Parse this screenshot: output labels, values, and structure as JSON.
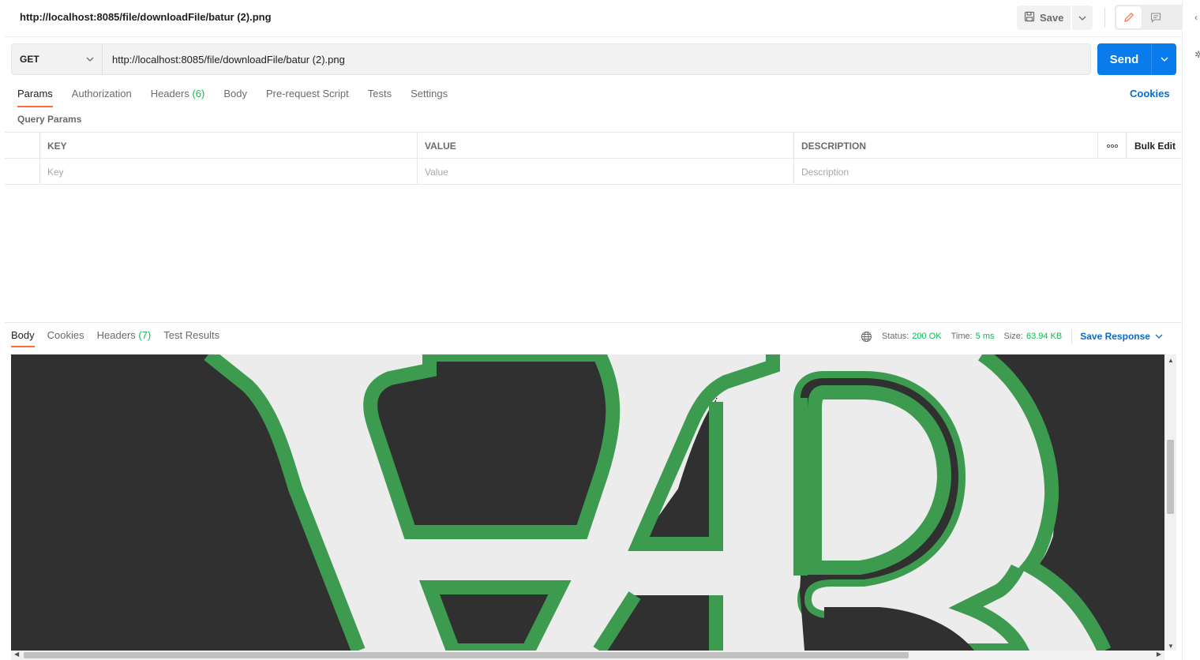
{
  "header": {
    "title": "http://localhost:8085/file/downloadFile/batur (2).png",
    "save_label": "Save"
  },
  "request": {
    "method": "GET",
    "url": "http://localhost:8085/file/downloadFile/batur (2).png",
    "send_label": "Send"
  },
  "request_tabs": {
    "params": "Params",
    "authorization": "Authorization",
    "headers": "Headers",
    "headers_count": "(6)",
    "body": "Body",
    "prerequest": "Pre-request Script",
    "tests": "Tests",
    "settings": "Settings",
    "cookies": "Cookies"
  },
  "query_params": {
    "title": "Query Params",
    "columns": {
      "key": "KEY",
      "value": "VALUE",
      "description": "DESCRIPTION",
      "bulk_edit": "Bulk Edit"
    },
    "placeholders": {
      "key": "Key",
      "value": "Value",
      "description": "Description"
    }
  },
  "response": {
    "tabs": {
      "body": "Body",
      "cookies": "Cookies",
      "headers": "Headers",
      "headers_count": "(7)",
      "test_results": "Test Results"
    },
    "status_label": "Status:",
    "status_value": "200 OK",
    "time_label": "Time:",
    "time_value": "5 ms",
    "size_label": "Size:",
    "size_value": "63.94 KB",
    "save_response": "Save Response"
  },
  "colors": {
    "accent": "#ff6c37",
    "send": "#097bed",
    "link": "#0b6bcb",
    "status_ok": "#0cbb52",
    "image_dark": "#303030",
    "image_light": "#ececec",
    "image_green": "#3d9b50"
  }
}
